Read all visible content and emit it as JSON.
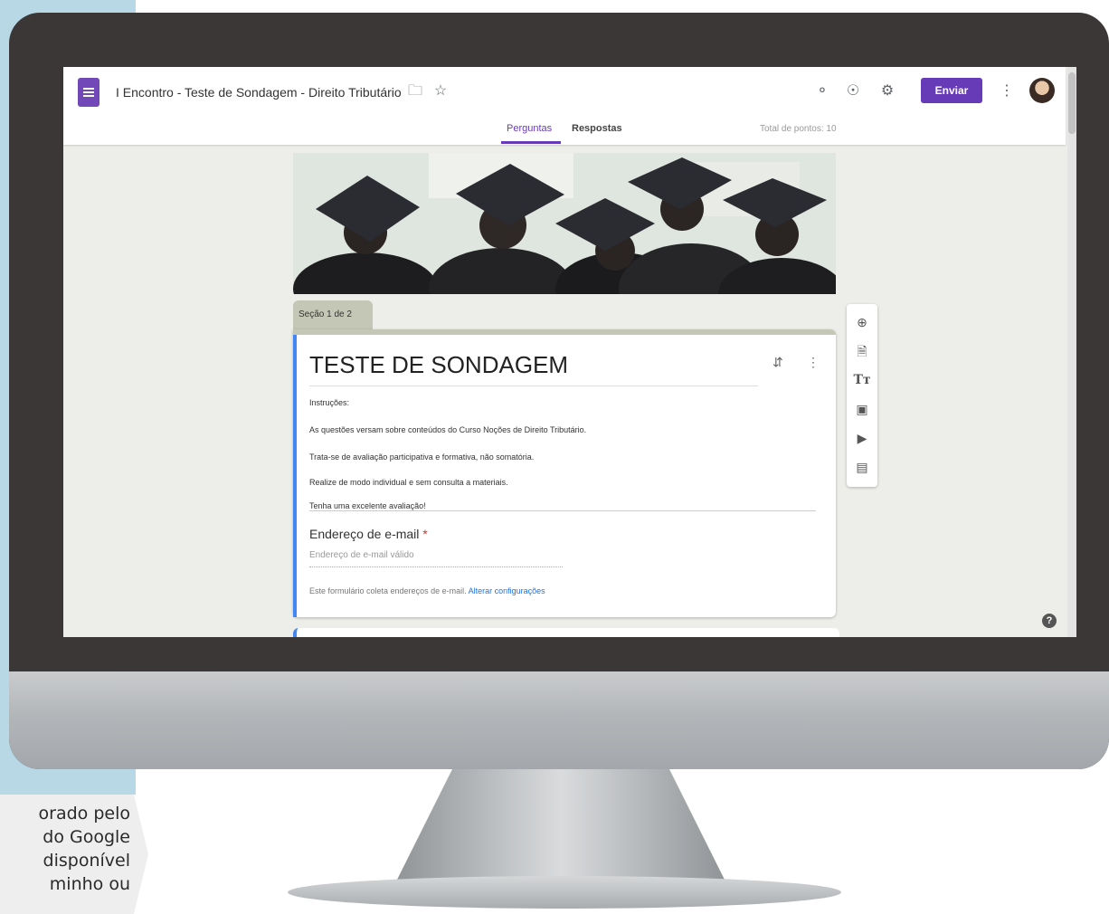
{
  "caption": {
    "lines": [
      "orado pelo",
      "do Google",
      "disponível",
      "minho ou"
    ]
  },
  "form_app": {
    "title": "I Encontro - Teste de Sondagem - Direito Tributário",
    "send_label": "Enviar",
    "tabs": [
      {
        "label": "Perguntas",
        "active": true
      },
      {
        "label": "Respostas",
        "active": false
      }
    ],
    "total_points": "Total de pontos: 10",
    "section_label": "Seção 1 de 2",
    "form_title": "TESTE DE SONDAGEM",
    "description_lines": [
      "Instruções:",
      "As questões versam sobre conteúdos do Curso Noções de Direito Tributário.",
      "Trata-se de avaliação participativa e formativa, não somatória.",
      "Realize de modo individual e sem consulta a materiais.",
      "Tenha uma excelente avaliação!"
    ],
    "email": {
      "label": "Endereço de e-mail",
      "required_mark": "*",
      "placeholder": "Endereço de e-mail válido",
      "note": "Este formulário coleta endereços de e-mail.",
      "note_link": "Alterar configurações"
    },
    "icons": {
      "palette": "palette-icon",
      "preview": "eye-icon",
      "settings": "gear-icon",
      "more": "more-vert-icon",
      "folder": "folder-icon",
      "star": "star-icon",
      "help": "help-icon"
    },
    "side_tools": [
      "add-question-icon",
      "import-questions-icon",
      "add-title-icon",
      "add-image-icon",
      "add-video-icon",
      "add-section-icon"
    ],
    "accent_color": "#673ab7",
    "field_accent": "#4285f4"
  }
}
